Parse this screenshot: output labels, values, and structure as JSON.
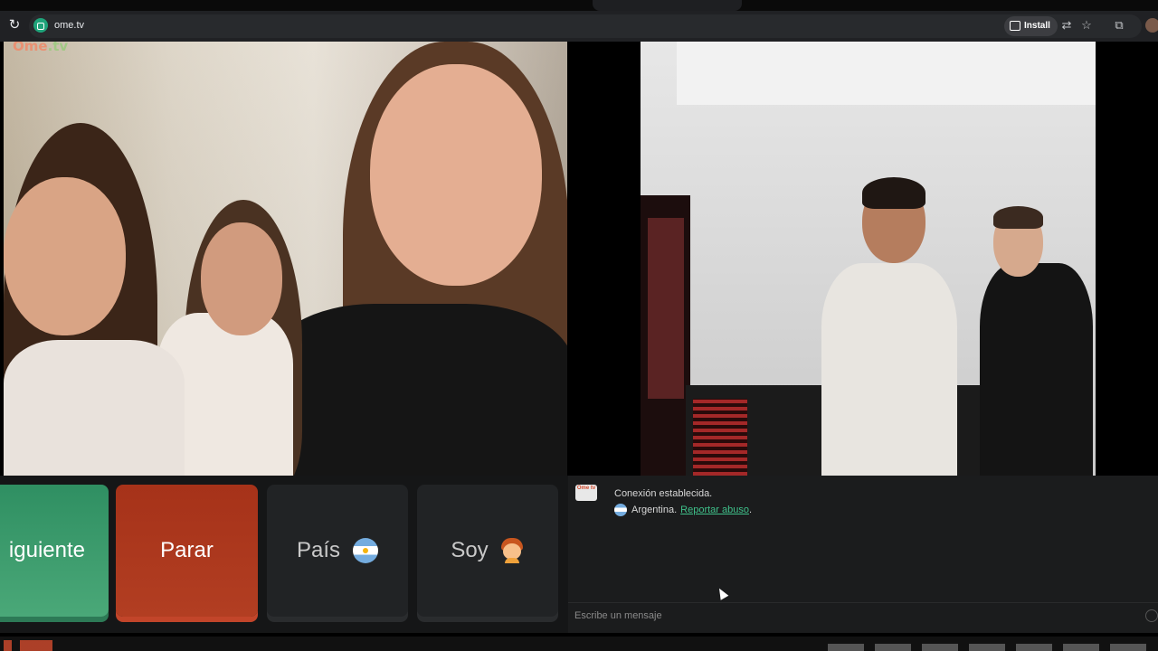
{
  "browser": {
    "url": "ome.tv",
    "install_label": "Install"
  },
  "video": {
    "logo_main": "Ome",
    "logo_suffix": ".tv"
  },
  "controls": {
    "next_label": "iguiente",
    "stop_label": "Parar",
    "country_label": "País",
    "soy_label": "Soy"
  },
  "chat": {
    "logo_text": "Ome tv",
    "message_connected": "Conexión establecida.",
    "country_name": "Argentina.",
    "report_label": "Reportar abuso",
    "report_suffix": ".",
    "input_placeholder": "Escribe un mensaje"
  }
}
